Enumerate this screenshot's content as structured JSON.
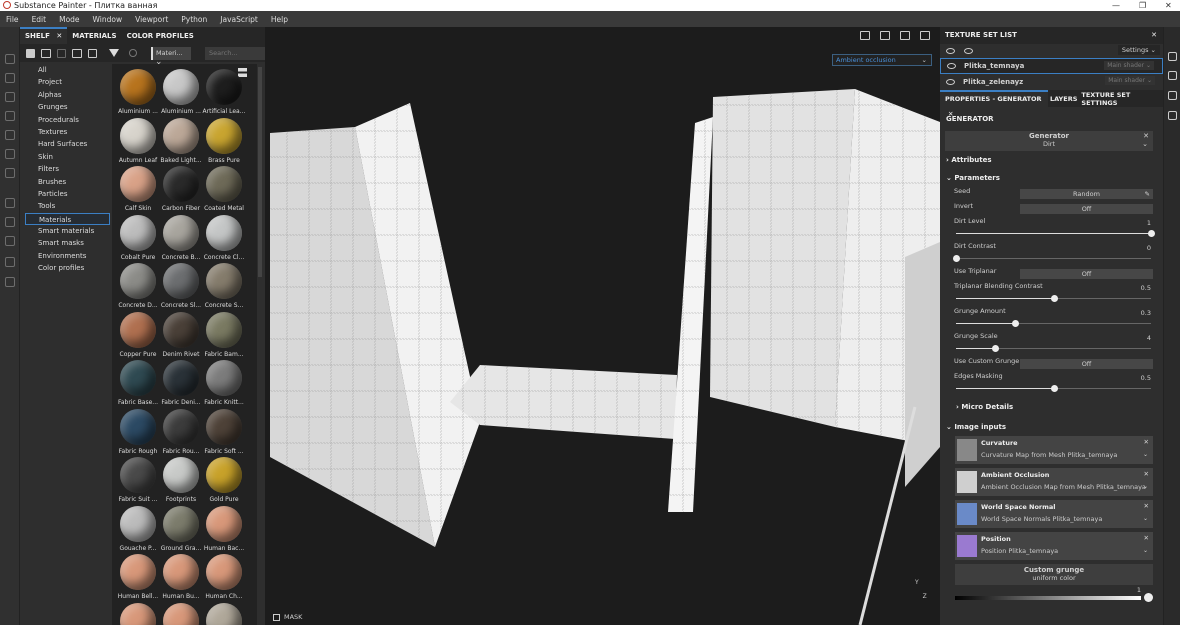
{
  "window": {
    "title": "Substance Painter - Плитка ванная",
    "minimize": "—",
    "maximize": "❐",
    "close": "✕"
  },
  "menu": [
    "File",
    "Edit",
    "Mode",
    "Window",
    "Viewport",
    "Python",
    "JavaScript",
    "Help"
  ],
  "shelf": {
    "tabs": [
      {
        "label": "SHELF",
        "close": "✕"
      },
      {
        "label": "MATERIALS"
      },
      {
        "label": "COLOR PROFILES"
      }
    ],
    "filter_chip": "Materi...",
    "filter_close": "✕",
    "search_placeholder": "Search...",
    "categories": [
      "All",
      "Project",
      "Alphas",
      "Grunges",
      "Procedurals",
      "Textures",
      "Hard Surfaces",
      "Skin",
      "Filters",
      "Brushes",
      "Particles",
      "Tools",
      "Materials",
      "Smart materials",
      "Smart masks",
      "Environments",
      "Color profiles"
    ],
    "selected_category": "Materials",
    "materials": [
      {
        "name": "Aluminium ...",
        "color": "#b8741e"
      },
      {
        "name": "Aluminium ...",
        "color": "#c8c8c8"
      },
      {
        "name": "Artificial Lea...",
        "color": "#1e1e1e"
      },
      {
        "name": "Autumn Leaf",
        "color": "#d8d4cc"
      },
      {
        "name": "Baked Light...",
        "color": "#bca898"
      },
      {
        "name": "Brass Pure",
        "color": "#c9a530"
      },
      {
        "name": "Calf Skin",
        "color": "#d9a288"
      },
      {
        "name": "Carbon Fiber",
        "color": "#2a2a2a"
      },
      {
        "name": "Coated Metal",
        "color": "#6e6a58"
      },
      {
        "name": "Cobalt Pure",
        "color": "#bdbdbd"
      },
      {
        "name": "Concrete B...",
        "color": "#a8a59e"
      },
      {
        "name": "Concrete Cl...",
        "color": "#c4c6c6"
      },
      {
        "name": "Concrete D...",
        "color": "#8c8c88"
      },
      {
        "name": "Concrete Sl...",
        "color": "#6c6e70"
      },
      {
        "name": "Concrete S...",
        "color": "#857c6c"
      },
      {
        "name": "Copper Pure",
        "color": "#b07050"
      },
      {
        "name": "Denim Rivet",
        "color": "#4a4038"
      },
      {
        "name": "Fabric Bam...",
        "color": "#7a7a62"
      },
      {
        "name": "Fabric Base...",
        "color": "#2f4a52"
      },
      {
        "name": "Fabric Deni...",
        "color": "#2a3238"
      },
      {
        "name": "Fabric Knitt...",
        "color": "#7c7c7c"
      },
      {
        "name": "Fabric Rough",
        "color": "#2c4a64"
      },
      {
        "name": "Fabric Rou...",
        "color": "#3c3c3c"
      },
      {
        "name": "Fabric Soft ...",
        "color": "#4e4238"
      },
      {
        "name": "Fabric Suit ...",
        "color": "#4a4a4a"
      },
      {
        "name": "Footprints",
        "color": "#c8cac8"
      },
      {
        "name": "Gold Pure",
        "color": "#c8a22a"
      },
      {
        "name": "Gouache P...",
        "color": "#bcbcbc"
      },
      {
        "name": "Ground Gra...",
        "color": "#7c7c6c"
      },
      {
        "name": "Human Bac...",
        "color": "#d8987a"
      },
      {
        "name": "Human Bell...",
        "color": "#d8987a"
      },
      {
        "name": "Human Bu...",
        "color": "#d8987a"
      },
      {
        "name": "Human Ch...",
        "color": "#d8987a"
      },
      {
        "name": "",
        "color": "#d8987a"
      },
      {
        "name": "",
        "color": "#d8987a"
      },
      {
        "name": "",
        "color": "#b0a89a"
      }
    ]
  },
  "viewport": {
    "channel": "Ambient occlusion",
    "mask_label": "MASK",
    "axis": {
      "y": "Y",
      "z": "Z"
    }
  },
  "texture_set_list": {
    "title": "TEXTURE SET LIST",
    "settings": "Settings ⌄",
    "sets": [
      {
        "name": "Plitka_temnaya",
        "shader": "Main shader ⌄"
      },
      {
        "name": "Plitka_zelenayz",
        "shader": "Main shader ⌄"
      }
    ]
  },
  "properties": {
    "tabs": [
      {
        "label": "PROPERTIES - GENERATOR",
        "close": "✕"
      },
      {
        "label": "LAYERS"
      },
      {
        "label": "TEXTURE SET SETTINGS"
      }
    ],
    "section": "GENERATOR",
    "generator": {
      "title": "Generator",
      "value": "Dirt",
      "close": "✕",
      "chevron": "⌄"
    },
    "attributes": "Attributes",
    "parameters": "Parameters",
    "seed": {
      "label": "Seed",
      "value": "Random"
    },
    "invert": {
      "label": "Invert",
      "value": "Off"
    },
    "dirt_level": {
      "label": "Dirt Level",
      "value": "1",
      "fraction": 1.0
    },
    "dirt_contrast": {
      "label": "Dirt Contrast",
      "value": "0",
      "fraction": 0.0
    },
    "use_triplanar": {
      "label": "Use Triplanar",
      "value": "Off"
    },
    "triplanar_contrast": {
      "label": "Triplanar Blending Contrast",
      "value": "0.5",
      "fraction": 0.5
    },
    "grunge_amount": {
      "label": "Grunge Amount",
      "value": "0.3",
      "fraction": 0.3
    },
    "grunge_scale": {
      "label": "Grunge Scale",
      "value": "4",
      "fraction": 0.2
    },
    "use_custom_grunge": {
      "label": "Use Custom Grunge",
      "value": "Off"
    },
    "edges_masking": {
      "label": "Edges Masking",
      "value": "0.5",
      "fraction": 0.5
    },
    "micro_details": "Micro Details",
    "image_inputs": "Image inputs",
    "inputs": [
      {
        "title": "Curvature",
        "source": "Curvature Map from Mesh Plitka_temnaya",
        "color": "#888888"
      },
      {
        "title": "Ambient Occlusion",
        "source": "Ambient Occlusion Map from Mesh Plitka_temnaya",
        "color": "#cfcfcf"
      },
      {
        "title": "World Space Normal",
        "source": "World Space Normals Plitka_temnaya",
        "color": "#6a8ac8"
      },
      {
        "title": "Position",
        "source": "Position Plitka_temnaya",
        "color": "#9a7ad0"
      }
    ],
    "custom_grunge": {
      "title": "Custom grunge",
      "value": "uniform color"
    },
    "gradient_value": "1"
  }
}
